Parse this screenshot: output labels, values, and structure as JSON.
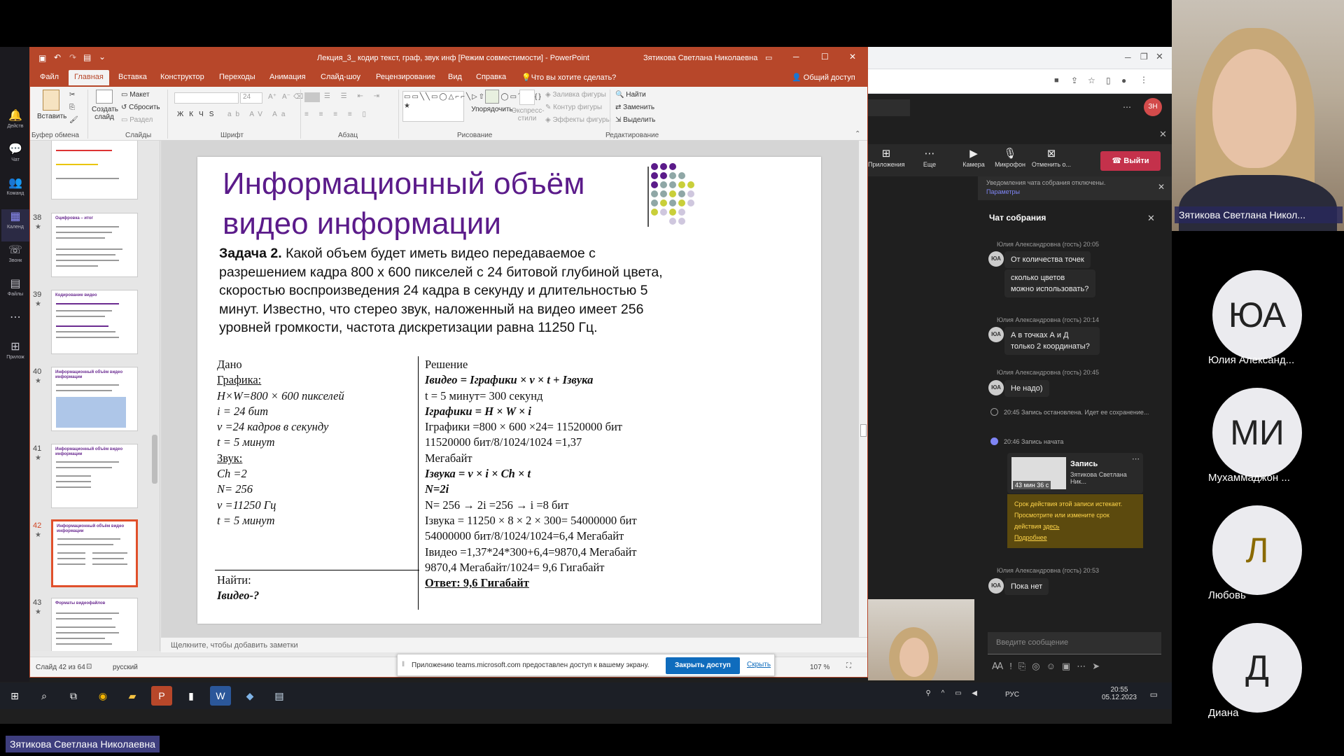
{
  "ppt": {
    "title": "Лекция_3_ кодир текст, граф, звук инф [Режим совместимости] - PowerPoint",
    "user": "Зятикова Светлана Николаевна",
    "tabs": [
      "Файл",
      "Главная",
      "Вставка",
      "Конструктор",
      "Переходы",
      "Анимация",
      "Слайд-шоу",
      "Рецензирование",
      "Вид",
      "Справка"
    ],
    "tell_me": "Что вы хотите сделать?",
    "share": "Общий доступ",
    "ribbon": {
      "paste": "Вставить",
      "clipboard": "Буфер обмена",
      "new_slide": "Создать слайд",
      "layout": "Макет",
      "reset": "Сбросить",
      "section": "Раздел",
      "slides": "Слайды",
      "font_size": "24",
      "font": "Шрифт",
      "paragraph": "Абзац",
      "arrange": "Упорядочить",
      "quick_styles": "Экспресс-стили",
      "shape_fill": "Заливка фигуры",
      "shape_outline": "Контур фигуры",
      "shape_effects": "Эффекты фигуры",
      "drawing": "Рисование",
      "find": "Найти",
      "replace": "Заменить",
      "select": "Выделить",
      "editing": "Редактирование"
    },
    "thumbs": [
      {
        "num": "38",
        "title": "Оцифровка – итог"
      },
      {
        "num": "39",
        "title": "Кодирование видео"
      },
      {
        "num": "40",
        "title": "Информационный объём видео информации"
      },
      {
        "num": "41",
        "title": "Информационный объём видео информации"
      },
      {
        "num": "42",
        "title": "Информационный объём видео информации"
      },
      {
        "num": "43",
        "title": "Форматы видеофайлов"
      }
    ],
    "notes_placeholder": "Щелкните, чтобы добавить заметки",
    "status_slide": "Слайд 42 из 64",
    "status_lang": "русский",
    "zoom": "107 %",
    "slide": {
      "title": "Информационный объём видео информации",
      "task_label": "Задача 2.",
      "task_text": "Какой объем будет иметь видео передаваемое с разрешением кадра 800 х 600 пикселей с 24 битовой глубиной цвета, скоростью воспроизведения 24 кадра в секунду и длительностью 5 минут. Известно, что стерео звук, наложенный на видео имеет 256  уровней громкости, частота дискретизации равна 11250 Гц.",
      "given": {
        "header": "Дано",
        "graphics_label": "Графика:",
        "g1": "H×W=800 × 600 пикселей",
        "g2": "i = 24 бит",
        "g3": "v =24 кадров в секунду",
        "g4": "t = 5 минут",
        "sound_label": "Звук:",
        "s1": "Ch =2",
        "s2": "N= 256",
        "s3": "v =11250 Гц",
        "s4": "t = 5 минут",
        "find_label": "Найти:",
        "find_val": "Iвидео-?"
      },
      "solution": {
        "header": "Решение",
        "l1": "Iвидео = Iграфики × v × t + Iзвука",
        "l2": "t = 5 минут= 300 секунд",
        "l3": "Iграфики = H × W × i",
        "l4": "Iграфики =800 × 600 ×24= 11520000 бит",
        "l5": "11520000 бит/8/1024/1024 =1,37",
        "l6": "Мегабайт",
        "l7": "Iзвука = v × i ×  Ch × t",
        "l8": "N=2i",
        "l9": "N= 256 → 2i =256 → i =8 бит",
        "l10": "Iзвука = 11250 × 8 × 2 × 300= 54000000 бит",
        "l11": "54000000 бит/8/1024/1024=6,4 Мегабайт",
        "l12": "Iвидео =1,37*24*300+6,4=9870,4 Мегабайт",
        "l13": "9870,4 Мегабайт/1024= 9,6 Гигабайт",
        "answer": "Ответ: 9,6 Гигабайт"
      }
    }
  },
  "share_banner": {
    "text": "Приложению teams.microsoft.com предоставлен доступ к вашему экрану.",
    "stop": "Закрыть доступ",
    "hide": "Скрыть"
  },
  "teams": {
    "rail": [
      "Действ",
      "Чат",
      "Команд",
      "Календ",
      "Звонк",
      "Файлы",
      "Прилож"
    ],
    "toolbar": {
      "apps": "Приложения",
      "more": "Еще",
      "camera": "Камера",
      "mic": "Микрофон",
      "share": "Отменить о...",
      "leave": "Выйти"
    },
    "notice": "Уведомления чата собрания отключены.",
    "notice_link": "Параметры",
    "chat_title": "Чат собрания",
    "messages": [
      {
        "meta": "Юлия Александровна (гость)  20:05",
        "avatar": "ЮА",
        "text1": "От количества точек",
        "text2": "сколько цветов можно использовать?"
      },
      {
        "meta": "Юлия Александровна (гость)  20:14",
        "avatar": "ЮА",
        "text1": "А в точках А и Д только 2 координаты?"
      },
      {
        "meta": "Юлия Александровна (гость)  20:45",
        "avatar": "ЮА",
        "text1": "Не надо)"
      }
    ],
    "sys1": "20:45   Запись остановлена. Идет ее сохранение...",
    "sys2": "20:46   Запись начата",
    "rec_title": "Запись",
    "rec_owner": "Зятикова Светлана Ник...",
    "rec_duration": "43 мин 36 с",
    "rec_warn": "Срок действия этой записи истекает. Просмотрите или измените срок действия",
    "rec_warn_link1": "здесь",
    "rec_warn_link2": "Подробнее",
    "last_meta": "Юлия Александровна (гость)  20:53",
    "last_text": "Пока нет",
    "input_placeholder": "Введите сообщение"
  },
  "gallery": {
    "presenter": "Зятикова Светлана Никол...",
    "participants": [
      {
        "initials": "ЮА",
        "name": "Юлия Александ..."
      },
      {
        "initials": "МИ",
        "name": "Мухаммаджон ..."
      },
      {
        "initials": "Л",
        "name": "Любовь"
      },
      {
        "initials": "Д",
        "name": "Диана"
      }
    ]
  },
  "taskbar": {
    "lang": "РУС",
    "time": "20:55",
    "date": "05.12.2023"
  },
  "bottom_name": "Зятикова Светлана Николаевна",
  "colors": {
    "ppt_accent": "#b7472a",
    "slide_title": "#5b1b8a",
    "teams_leave": "#c4314b",
    "teams_accent": "#7f85f5"
  }
}
